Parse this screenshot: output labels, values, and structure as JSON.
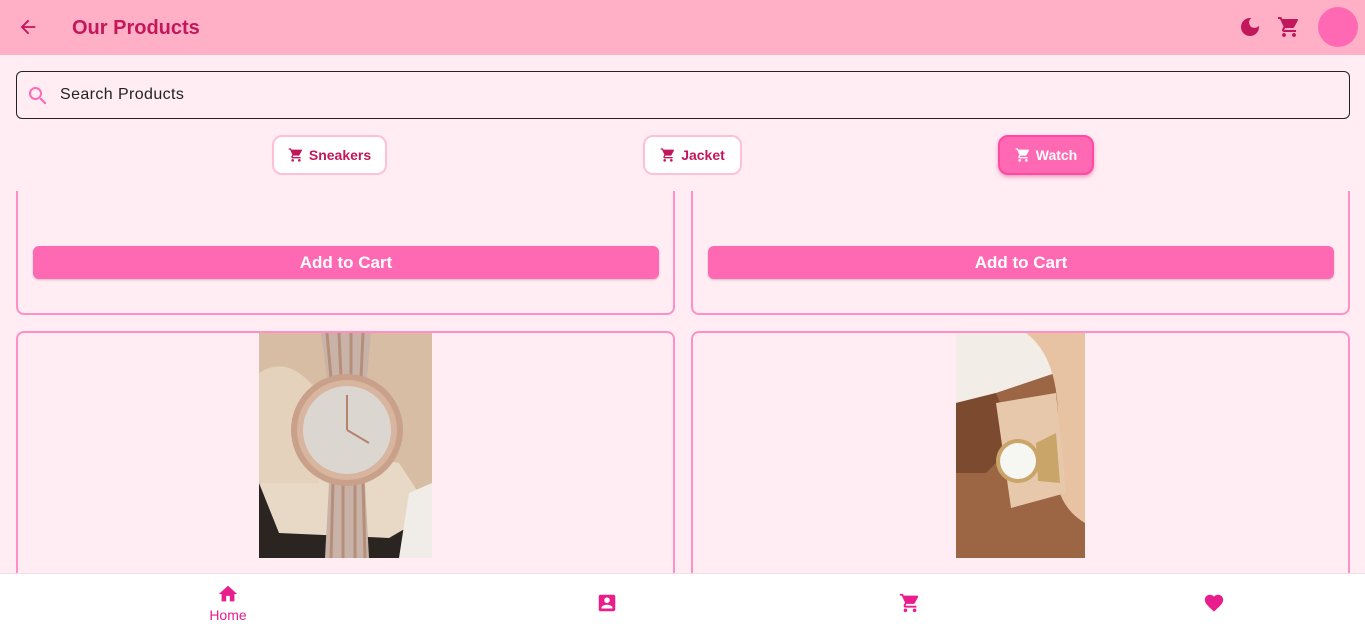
{
  "app_bar": {
    "title": "Our Products",
    "back_icon": "arrow-back-icon",
    "theme_icon": "moon-icon",
    "cart_icon": "cart-icon",
    "colors": {
      "background": "#ffb0c7",
      "title": "#c2185b",
      "avatar": "#ff69b4"
    }
  },
  "search": {
    "placeholder": "Search Products",
    "value": ""
  },
  "categories": [
    {
      "label": "Sneakers",
      "icon": "cart-icon",
      "selected": false
    },
    {
      "label": "Jacket",
      "icon": "cart-icon",
      "selected": false
    },
    {
      "label": "Watch",
      "icon": "cart-icon",
      "selected": true
    }
  ],
  "products": {
    "cards": [
      {
        "button_label": "Add to Cart"
      },
      {
        "button_label": "Add to Cart"
      },
      {
        "image": "silver-rose-gold-watch-in-box"
      },
      {
        "image": "gold-watch-on-wrist"
      }
    ],
    "accent": "#ff69b4"
  },
  "bottom_nav": {
    "items": [
      {
        "label": "Home",
        "icon": "home-icon",
        "active": true
      },
      {
        "label": "",
        "icon": "profile-icon",
        "active": false
      },
      {
        "label": "",
        "icon": "cart-icon",
        "active": false
      },
      {
        "label": "",
        "icon": "heart-icon",
        "active": false
      }
    ],
    "active_color": "#e91e8c"
  }
}
